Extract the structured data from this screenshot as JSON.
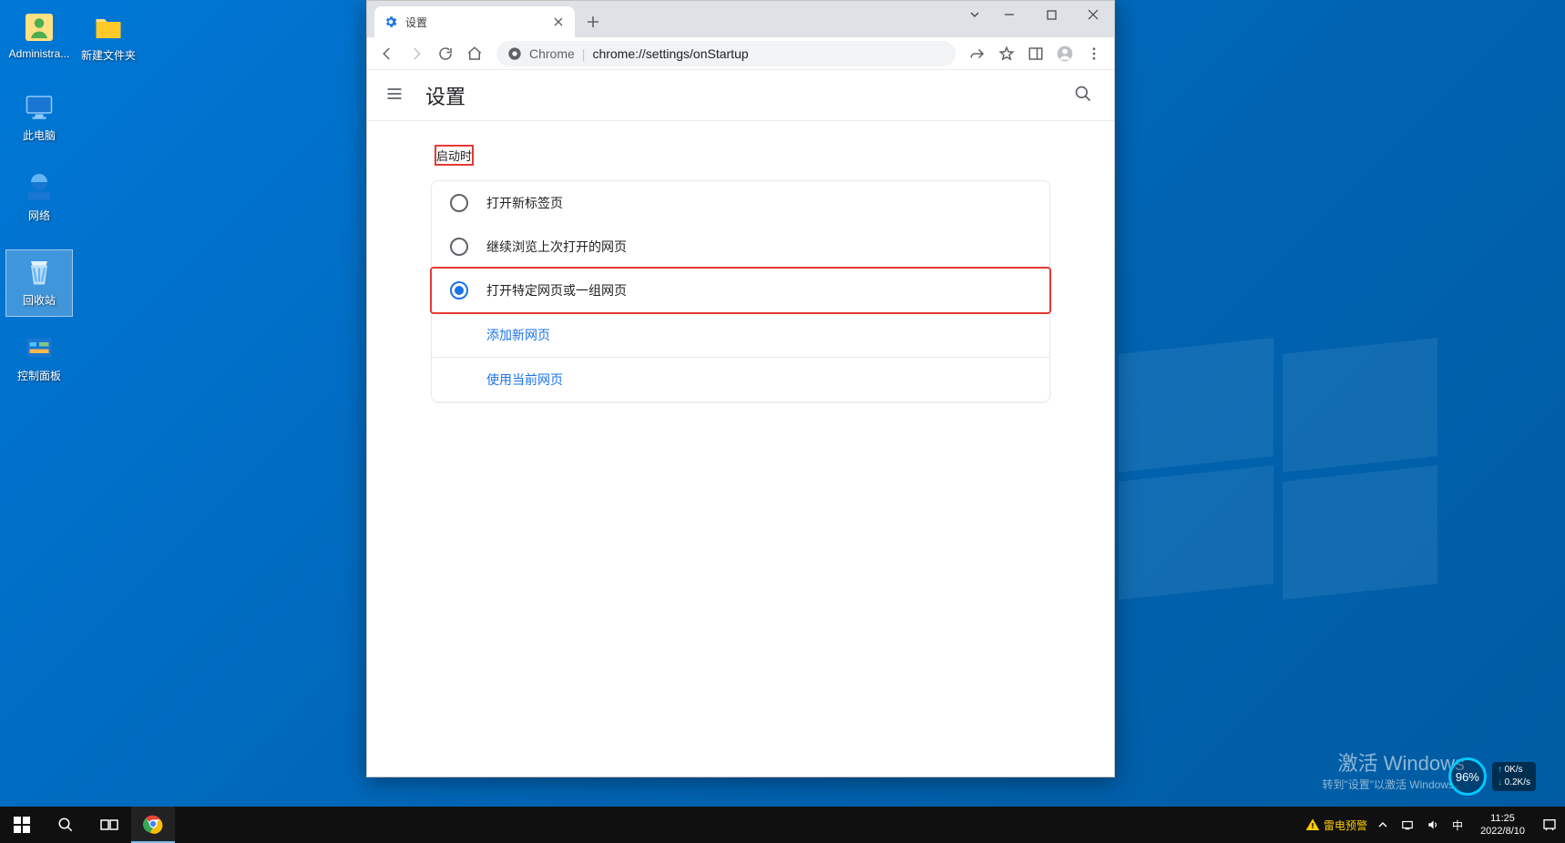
{
  "desktop": {
    "icons_col1": [
      {
        "label": "Administra...",
        "kind": "user"
      },
      {
        "label": "此电脑",
        "kind": "pc"
      },
      {
        "label": "网络",
        "kind": "network"
      },
      {
        "label": "回收站",
        "kind": "recycle",
        "selected": true
      },
      {
        "label": "控制面板",
        "kind": "control"
      }
    ],
    "icons_col2": [
      {
        "label": "新建文件夹",
        "kind": "folder"
      }
    ]
  },
  "chrome": {
    "tab_title": "设置",
    "omnibox": {
      "host": "Chrome",
      "path": "chrome://settings/onStartup"
    },
    "settings_title": "设置",
    "section": "启动时",
    "radios": [
      {
        "label": "打开新标签页",
        "selected": false,
        "highlight": false
      },
      {
        "label": "继续浏览上次打开的网页",
        "selected": false,
        "highlight": false
      },
      {
        "label": "打开特定网页或一组网页",
        "selected": true,
        "highlight": true
      }
    ],
    "links": [
      "添加新网页",
      "使用当前网页"
    ]
  },
  "watermark": {
    "l1": "激活 Windows",
    "l2": "转到\"设置\"以激活 Windows。"
  },
  "netmon": {
    "pct": "96%",
    "up": "0K/s",
    "dn": "0.2K/s"
  },
  "taskbar": {
    "warning": "雷电预警",
    "ime": "中",
    "time": "11:25",
    "date": "2022/8/10"
  }
}
